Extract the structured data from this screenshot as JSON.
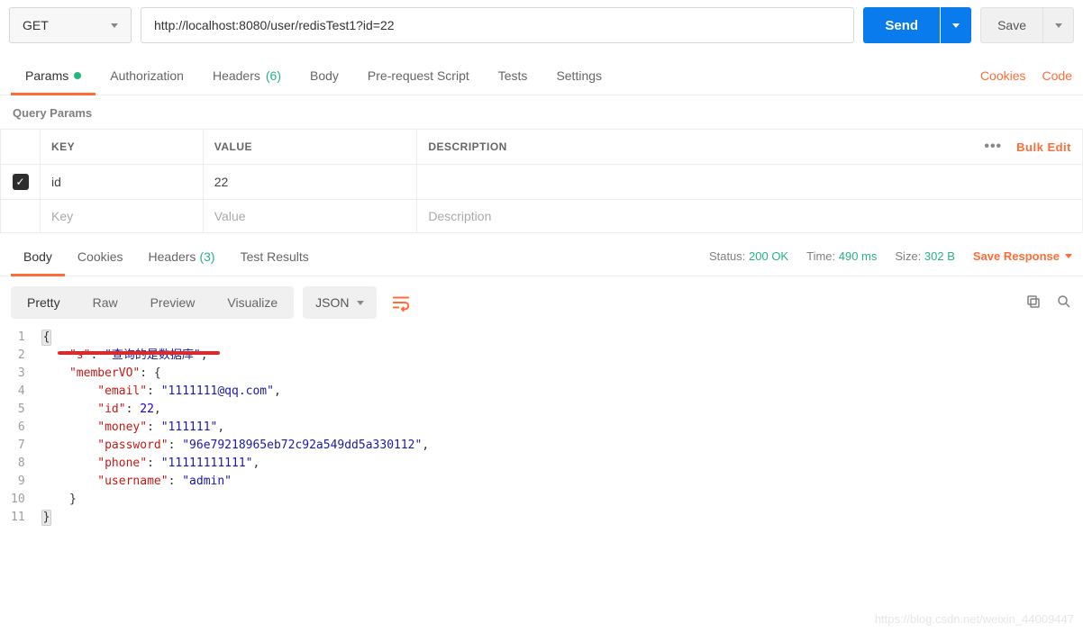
{
  "request": {
    "method": "GET",
    "url": "http://localhost:8080/user/redisTest1?id=22",
    "send_label": "Send",
    "save_label": "Save"
  },
  "req_tabs": {
    "items": [
      {
        "label": "Params",
        "active": true,
        "dot": true
      },
      {
        "label": "Authorization"
      },
      {
        "label": "Headers",
        "count": "(6)"
      },
      {
        "label": "Body"
      },
      {
        "label": "Pre-request Script"
      },
      {
        "label": "Tests"
      },
      {
        "label": "Settings"
      }
    ],
    "right_links": {
      "cookies": "Cookies",
      "code": "Code"
    }
  },
  "query_params": {
    "section_label": "Query Params",
    "headers": {
      "key": "KEY",
      "value": "VALUE",
      "description": "DESCRIPTION",
      "bulk": "Bulk Edit"
    },
    "rows": [
      {
        "checked": true,
        "key": "id",
        "value": "22",
        "description": ""
      }
    ],
    "placeholders": {
      "key": "Key",
      "value": "Value",
      "description": "Description"
    }
  },
  "resp_tabs": {
    "items": [
      {
        "label": "Body",
        "active": true
      },
      {
        "label": "Cookies"
      },
      {
        "label": "Headers",
        "count": "(3)"
      },
      {
        "label": "Test Results"
      }
    ],
    "meta": {
      "status_label": "Status:",
      "status_val": "200 OK",
      "time_label": "Time:",
      "time_val": "490 ms",
      "size_label": "Size:",
      "size_val": "302 B"
    },
    "save_response": "Save Response"
  },
  "resp_toolbar": {
    "views": [
      "Pretty",
      "Raw",
      "Preview",
      "Visualize"
    ],
    "active_view": "Pretty",
    "format": "JSON"
  },
  "response_body": {
    "lines": [
      [
        {
          "t": "punc",
          "v": "{"
        }
      ],
      [
        {
          "t": "indent",
          "v": "    "
        },
        {
          "t": "key",
          "v": "\"s\""
        },
        {
          "t": "punc",
          "v": ": "
        },
        {
          "t": "str",
          "v": "\"查询的是数据库\""
        },
        {
          "t": "punc",
          "v": ","
        }
      ],
      [
        {
          "t": "indent",
          "v": "    "
        },
        {
          "t": "key",
          "v": "\"memberVO\""
        },
        {
          "t": "punc",
          "v": ": {"
        }
      ],
      [
        {
          "t": "indent",
          "v": "        "
        },
        {
          "t": "key",
          "v": "\"email\""
        },
        {
          "t": "punc",
          "v": ": "
        },
        {
          "t": "str",
          "v": "\"1111111@qq.com\""
        },
        {
          "t": "punc",
          "v": ","
        }
      ],
      [
        {
          "t": "indent",
          "v": "        "
        },
        {
          "t": "key",
          "v": "\"id\""
        },
        {
          "t": "punc",
          "v": ": "
        },
        {
          "t": "num",
          "v": "22"
        },
        {
          "t": "punc",
          "v": ","
        }
      ],
      [
        {
          "t": "indent",
          "v": "        "
        },
        {
          "t": "key",
          "v": "\"money\""
        },
        {
          "t": "punc",
          "v": ": "
        },
        {
          "t": "str",
          "v": "\"111111\""
        },
        {
          "t": "punc",
          "v": ","
        }
      ],
      [
        {
          "t": "indent",
          "v": "        "
        },
        {
          "t": "key",
          "v": "\"password\""
        },
        {
          "t": "punc",
          "v": ": "
        },
        {
          "t": "str",
          "v": "\"96e79218965eb72c92a549dd5a330112\""
        },
        {
          "t": "punc",
          "v": ","
        }
      ],
      [
        {
          "t": "indent",
          "v": "        "
        },
        {
          "t": "key",
          "v": "\"phone\""
        },
        {
          "t": "punc",
          "v": ": "
        },
        {
          "t": "str",
          "v": "\"11111111111\""
        },
        {
          "t": "punc",
          "v": ","
        }
      ],
      [
        {
          "t": "indent",
          "v": "        "
        },
        {
          "t": "key",
          "v": "\"username\""
        },
        {
          "t": "punc",
          "v": ": "
        },
        {
          "t": "str",
          "v": "\"admin\""
        }
      ],
      [
        {
          "t": "indent",
          "v": "    "
        },
        {
          "t": "punc",
          "v": "}"
        }
      ],
      [
        {
          "t": "punc",
          "v": "}"
        }
      ]
    ]
  },
  "watermark": "https://blog.csdn.net/weixin_44009447"
}
